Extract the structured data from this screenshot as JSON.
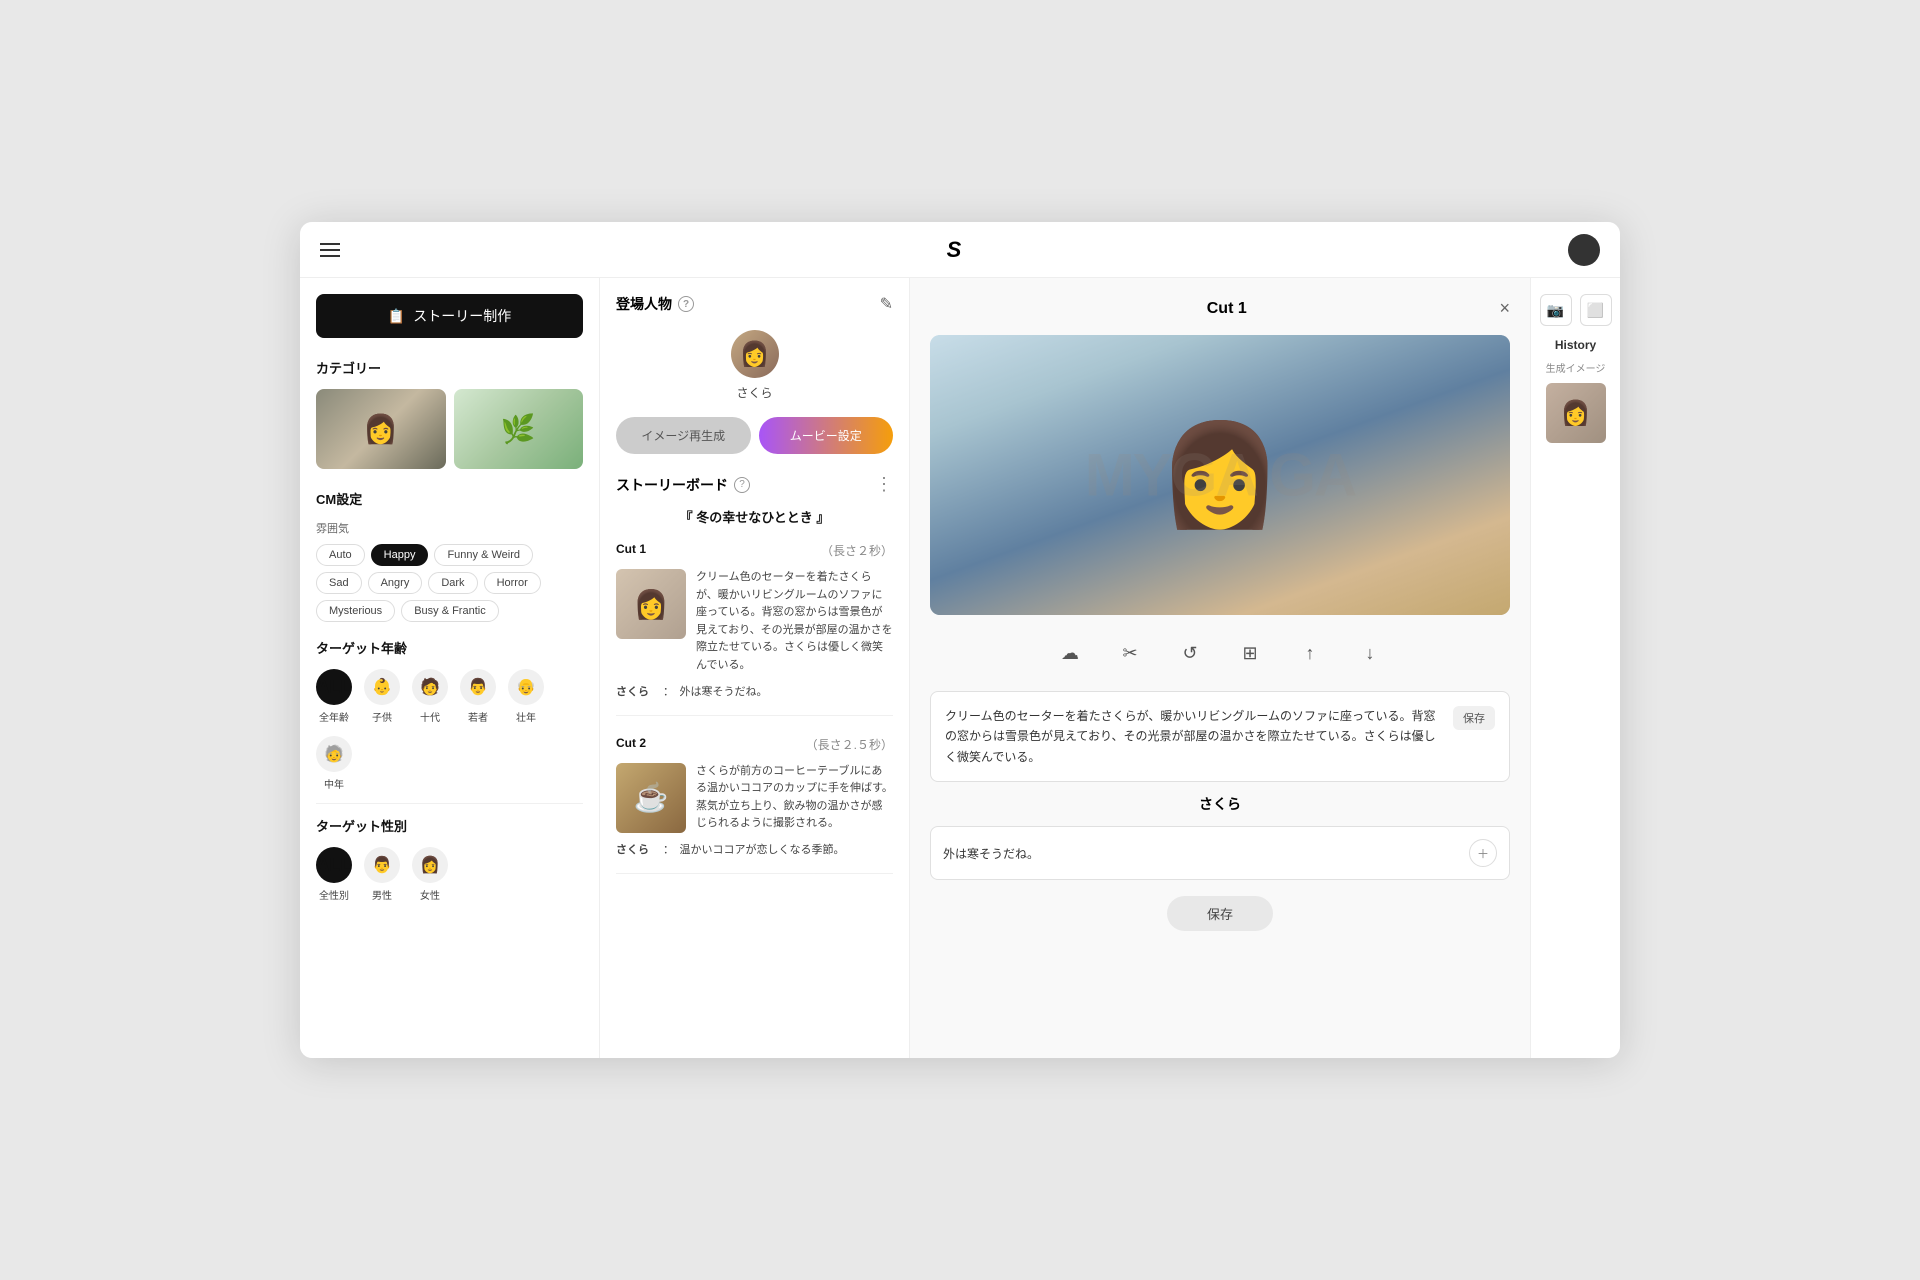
{
  "header": {
    "logo": "S",
    "hamburger_label": "menu"
  },
  "sidebar": {
    "create_btn": "ストーリー制作",
    "categories_label": "カテゴリー",
    "cm_label": "CM設定",
    "mood_label": "雰囲気",
    "mood_tags": [
      {
        "id": "auto",
        "label": "Auto",
        "active": false
      },
      {
        "id": "happy",
        "label": "Happy",
        "active": true
      },
      {
        "id": "funny",
        "label": "Funny & Weird",
        "active": false
      },
      {
        "id": "sad",
        "label": "Sad",
        "active": false
      },
      {
        "id": "angry",
        "label": "Angry",
        "active": false
      },
      {
        "id": "dark",
        "label": "Dark",
        "active": false
      },
      {
        "id": "horror",
        "label": "Horror",
        "active": false
      },
      {
        "id": "mysterious",
        "label": "Mysterious",
        "active": false
      },
      {
        "id": "busy",
        "label": "Busy & Frantic",
        "active": false
      }
    ],
    "target_age_label": "ターゲット年齢",
    "target_age_items": [
      {
        "id": "all",
        "label": "全年齢",
        "icon": "ALL",
        "selected": true
      },
      {
        "id": "child",
        "label": "子供",
        "icon": "👶"
      },
      {
        "id": "teen",
        "label": "十代",
        "icon": "🧑"
      },
      {
        "id": "young",
        "label": "若者",
        "icon": "👨"
      },
      {
        "id": "adult",
        "label": "壮年",
        "icon": "👴"
      },
      {
        "id": "middle",
        "label": "中年",
        "icon": "🧓"
      }
    ],
    "target_gender_label": "ターゲット性別",
    "target_gender_items": [
      {
        "id": "all",
        "label": "全性別",
        "icon": "ALL",
        "selected": true
      },
      {
        "id": "male",
        "label": "男性",
        "icon": "👨"
      },
      {
        "id": "female",
        "label": "女性",
        "icon": "👩"
      }
    ]
  },
  "middle_panel": {
    "characters_label": "登場人物",
    "character_name": "さくら",
    "btn_regenerate": "イメージ再生成",
    "btn_movie": "ムービー設定",
    "storyboard_label": "ストーリーボード",
    "story_title": "『 冬の幸せなひととき 』",
    "cuts": [
      {
        "id": "Cut 1",
        "duration": "（長さ２秒）",
        "desc": "クリーム色のセーターを着たさくらが、暖かいリビングルームのソファに座っている。背窓の窓からは雪景色が見えており、その光景が部屋の温かさを際立たせている。さくらは優しく微笑んでいる。",
        "speaker": "さくら",
        "dialog": "： 外は寒そうだね。"
      },
      {
        "id": "Cut 2",
        "duration": "（長さ２.５秒）",
        "desc": "さくらが前方のコーヒーテーブルにある温かいココアのカップに手を伸ばす。蒸気が立ち上り、飲み物の温かさが感じられるように撮影される。",
        "speaker": "さくら",
        "dialog": "： 温かいココアが恋しくなる季節。"
      }
    ]
  },
  "modal": {
    "title": "Cut 1",
    "close_label": "×",
    "scene_desc": "クリーム色のセーターを着たさくらが、暖かいリビングルームのソファに座っている。背窓の窓からは雪景色が見えており、その光景が部屋の温かさを際立たせている。さくらは優しく微笑んでいる。",
    "save_label": "保存",
    "character_name": "さくら",
    "dialog": "外は寒そうだね。",
    "save_center_label": "保存",
    "toolbar_icons": [
      "☁",
      "✂",
      "↺",
      "⊞",
      "↑",
      "↓"
    ]
  },
  "history_panel": {
    "title": "History",
    "sub": "生成イメージ"
  }
}
